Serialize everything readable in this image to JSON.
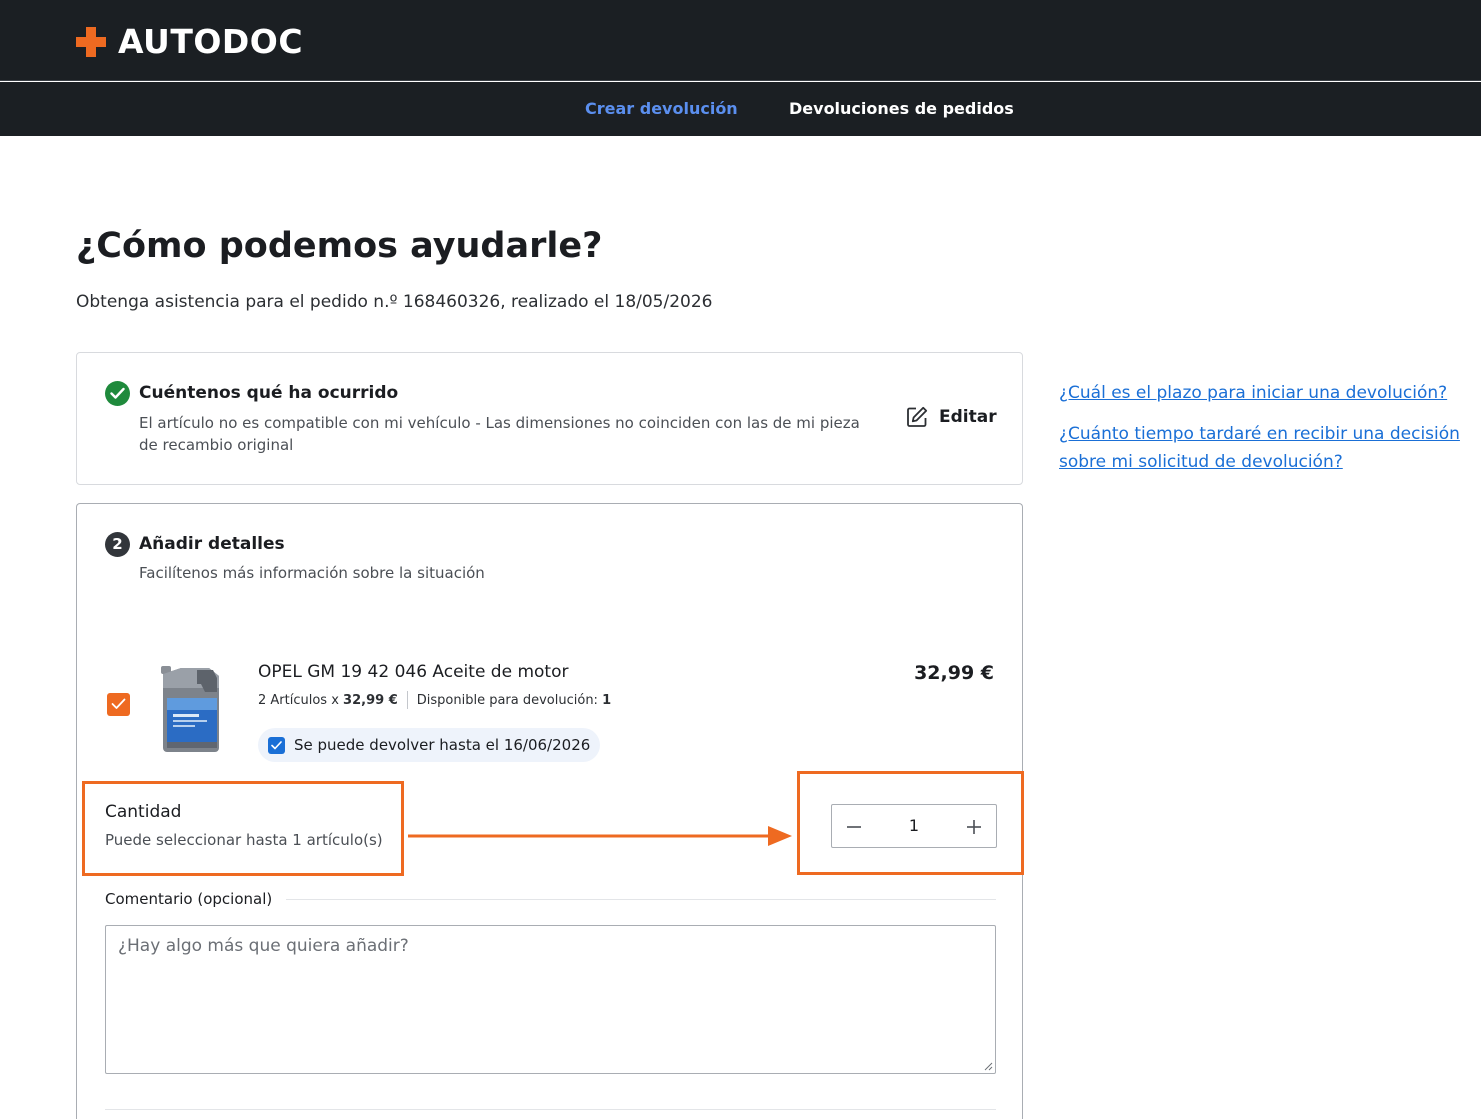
{
  "brand": {
    "name": "AUTODOC",
    "accent_color": "#ee6a21"
  },
  "nav": {
    "tabs": [
      {
        "label": "Crear devolución",
        "active": true
      },
      {
        "label": "Devoluciones de pedidos",
        "active": false
      }
    ]
  },
  "page": {
    "title": "¿Cómo podemos ayudarle?",
    "subtitle": "Obtenga asistencia para el pedido n.º 168460326, realizado el 18/05/2026"
  },
  "step1": {
    "title": "Cuéntenos qué ha ocurrido",
    "description": "El artículo no es compatible con mi vehículo - Las dimensiones no coinciden con las de mi pieza de recambio original",
    "edit_label": "Editar",
    "status_icon": "check-circle-icon"
  },
  "help_links": [
    "¿Cuál es el plazo para iniciar una devolución?",
    "¿Cuánto tiempo tardaré en recibir una decisión sobre mi solicitud de devolución?"
  ],
  "step2": {
    "number": "2",
    "title": "Añadir detalles",
    "description": "Facilítenos más información sobre la situación",
    "product": {
      "selected": true,
      "name": "OPEL GM 19 42 046 Aceite de motor",
      "qty_text": "2 Artículos x",
      "unit_price": "32,99 €",
      "available_label": "Disponible para devolución:",
      "available_value": "1",
      "price": "32,99 €",
      "return_until": "Se puede devolver hasta el 16/06/2026"
    },
    "quantity": {
      "title": "Cantidad",
      "hint": "Puede seleccionar hasta 1 artículo(s)",
      "value": "1"
    },
    "comment": {
      "label": "Comentario (opcional)",
      "placeholder": "¿Hay algo más que quiera añadir?",
      "value": ""
    }
  }
}
